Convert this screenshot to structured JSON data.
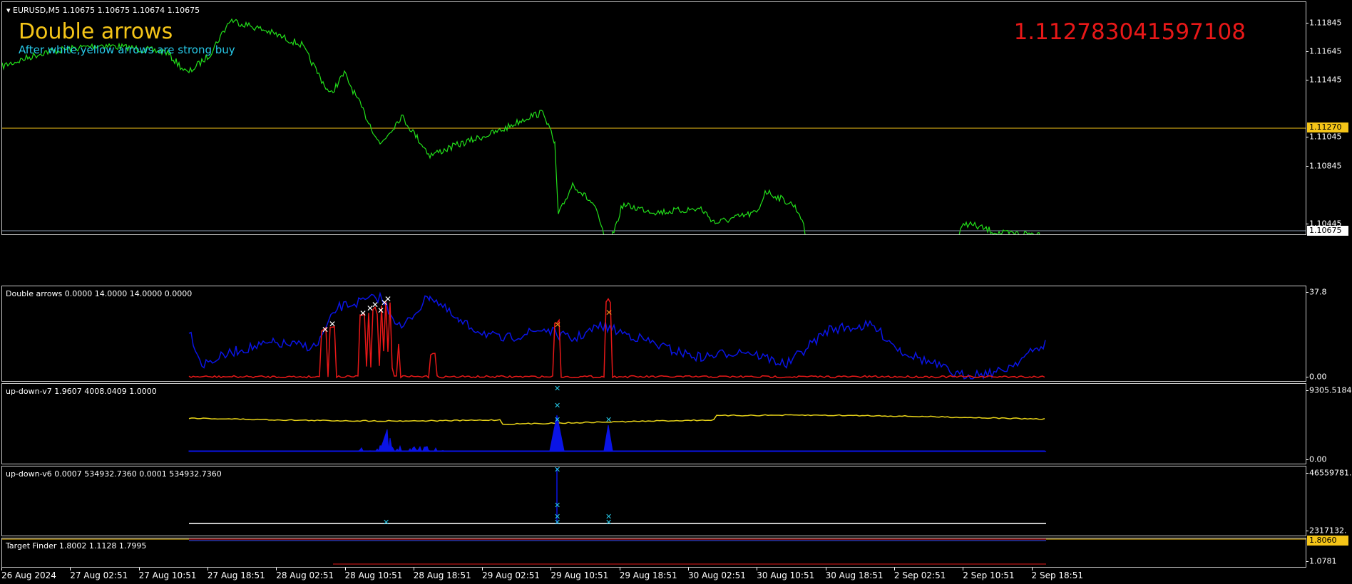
{
  "symbol_bar": {
    "icon": "triangle-down-icon",
    "text": "EURUSD,M5  1.10675 1.10675 1.10674 1.10675"
  },
  "overlay": {
    "title": "Double arrows",
    "subtitle": "After white,yellow arrows are strong buy",
    "big_value": "1.112783041597108",
    "title_color": "#f5c518",
    "subtitle_color": "#27c9e8",
    "value_color": "#e81818"
  },
  "main_axis": {
    "ticks": [
      "1.11845",
      "1.11645",
      "1.11445",
      "1.11045",
      "1.10845",
      "1.10445"
    ],
    "level_line": "1.11270",
    "current_price": "1.10675"
  },
  "panels": [
    {
      "label": "Double arrows 0.0000 14.0000 14.0000 0.0000",
      "axis_top": "37.8",
      "axis_bottom": "0.00"
    },
    {
      "label": "up-down-v7 1.9607 4008.0409 1.0000",
      "axis_top": "9305.5184",
      "axis_bottom": "0.00"
    },
    {
      "label": "up-down-v6 0.0007 534932.7360 0.0001 534932.7360",
      "axis_top": "46559781.",
      "axis_bottom": "2317132."
    },
    {
      "label": "Target Finder 1.8002 1.1128 1.7995",
      "axis_top": "1.8060",
      "axis_bottom": "1.0781"
    }
  ],
  "time_axis": [
    "26 Aug 2024",
    "27 Aug 02:51",
    "27 Aug 10:51",
    "27 Aug 18:51",
    "28 Aug 02:51",
    "28 Aug 10:51",
    "28 Aug 18:51",
    "29 Aug 02:51",
    "29 Aug 10:51",
    "29 Aug 18:51",
    "30 Aug 02:51",
    "30 Aug 10:51",
    "30 Aug 18:51",
    "2 Sep 02:51",
    "2 Sep 10:51",
    "2 Sep 18:51"
  ],
  "colors": {
    "price_line": "#22e01a",
    "level_line": "#f5c518",
    "indicator_blue": "#0a14e6",
    "indicator_red": "#e81818",
    "indicator_yellow": "#e8d318",
    "marker_white": "#ffffff",
    "marker_cyan": "#27c9e8"
  }
}
